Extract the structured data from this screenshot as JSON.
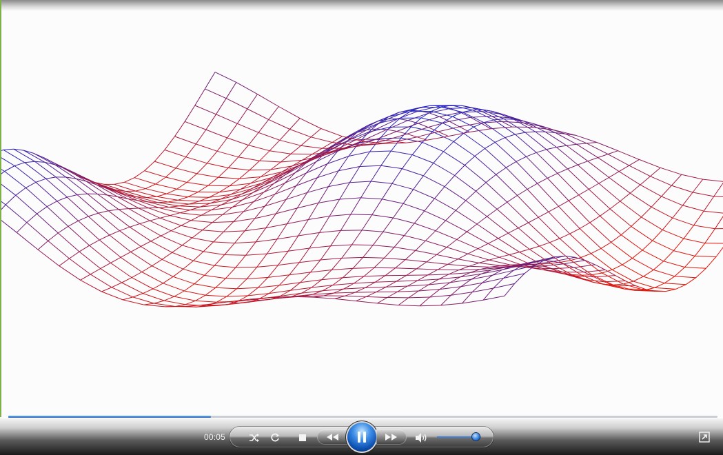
{
  "player": {
    "time_elapsed": "00:05",
    "progress_fraction": 0.286,
    "volume_fraction": 0.88,
    "state": "playing"
  },
  "visualization": {
    "type": "wireframe-surface",
    "color_top": "#1a22c8",
    "color_bottom": "#e0140a"
  },
  "icons": {
    "shuffle": "shuffle-icon",
    "repeat": "repeat-icon",
    "stop": "stop-icon",
    "rewind": "rewind-icon",
    "pause": "pause-icon",
    "forward": "fast-forward-icon",
    "mute": "speaker-icon",
    "fullscreen": "fullscreen-icon"
  }
}
